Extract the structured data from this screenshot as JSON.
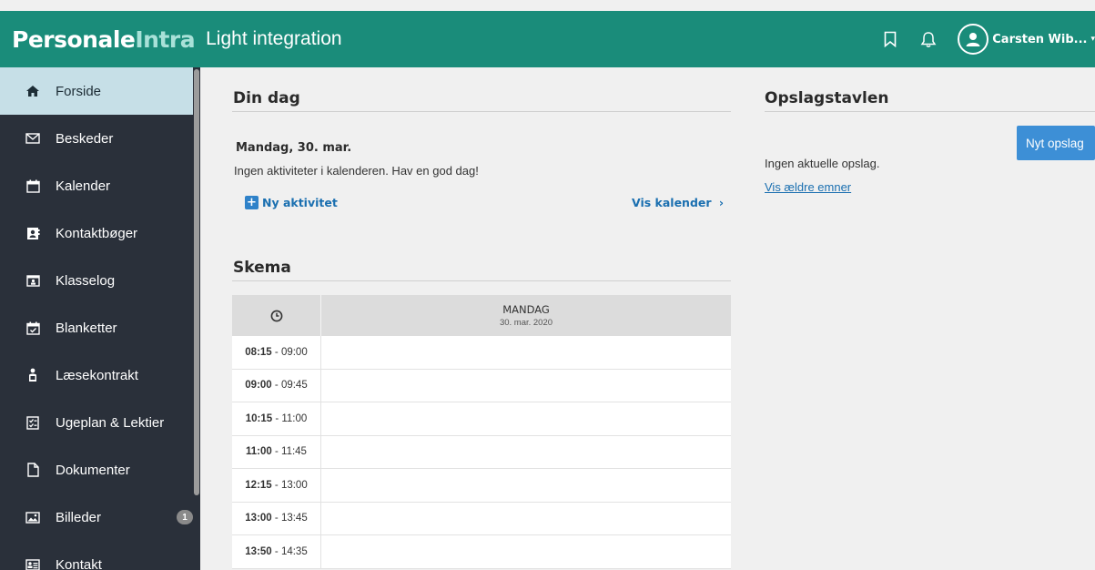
{
  "header": {
    "brand_main": "Personale",
    "brand_accent": "Intra",
    "subtitle": "Light integration",
    "username": "Carsten Wib...",
    "icons": [
      "bookmark-icon",
      "bell-icon",
      "user-avatar-icon"
    ]
  },
  "sidebar": {
    "items": [
      {
        "label": "Forside",
        "icon": "home-icon",
        "active": true
      },
      {
        "label": "Beskeder",
        "icon": "envelope-icon"
      },
      {
        "label": "Kalender",
        "icon": "calendar-icon"
      },
      {
        "label": "Kontaktbøger",
        "icon": "contact-book-icon"
      },
      {
        "label": "Klasselog",
        "icon": "class-log-icon"
      },
      {
        "label": "Blanketter",
        "icon": "form-calendar-icon"
      },
      {
        "label": "Læsekontrakt",
        "icon": "reader-icon"
      },
      {
        "label": "Ugeplan & Lektier",
        "icon": "checklist-icon"
      },
      {
        "label": "Dokumenter",
        "icon": "document-icon"
      },
      {
        "label": "Billeder",
        "icon": "image-icon",
        "badge": "1"
      },
      {
        "label": "Kontakt",
        "icon": "contact-card-icon"
      }
    ]
  },
  "din_dag": {
    "title": "Din dag",
    "date": "Mandag, 30. mar.",
    "text": "Ingen aktiviteter i kalenderen. Hav en god dag!",
    "new_activity": "Ny aktivitet",
    "show_calendar": "Vis kalender"
  },
  "skema": {
    "title": "Skema",
    "day_name": "MANDAG",
    "day_date": "30. mar. 2020",
    "rows": [
      {
        "start": "08:15",
        "end": "09:00"
      },
      {
        "start": "09:00",
        "end": "09:45"
      },
      {
        "start": "10:15",
        "end": "11:00"
      },
      {
        "start": "11:00",
        "end": "11:45"
      },
      {
        "start": "12:15",
        "end": "13:00"
      },
      {
        "start": "13:00",
        "end": "13:45"
      },
      {
        "start": "13:50",
        "end": "14:35"
      }
    ]
  },
  "opslagstavlen": {
    "title": "Opslagstavlen",
    "new_button": "Nyt opslag",
    "empty_text": "Ingen aktuelle opslag.",
    "older_link": "Vis ældre emner"
  },
  "colors": {
    "topbar": "#1a8c7a",
    "sidebar": "#2a303a",
    "sidebar_active": "#c6dfe7",
    "link": "#1a6fb0",
    "button": "#3d8fd6"
  }
}
